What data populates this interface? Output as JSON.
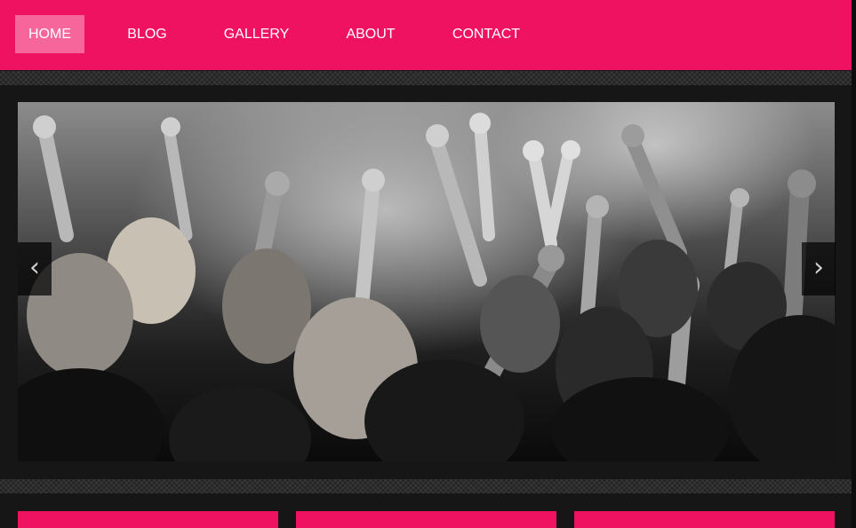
{
  "nav": {
    "items": [
      {
        "label": "HOME",
        "active": true
      },
      {
        "label": "BLOG",
        "active": false
      },
      {
        "label": "GALLERY",
        "active": false
      },
      {
        "label": "ABOUT",
        "active": false
      },
      {
        "label": "CONTACT",
        "active": false
      }
    ]
  },
  "slider": {
    "image": "concert-crowd-black-and-white",
    "prev_icon": "‹",
    "next_icon": "›"
  },
  "colors": {
    "accent": "#ef1260",
    "active_nav": "#f6669a",
    "background": "#161616"
  }
}
